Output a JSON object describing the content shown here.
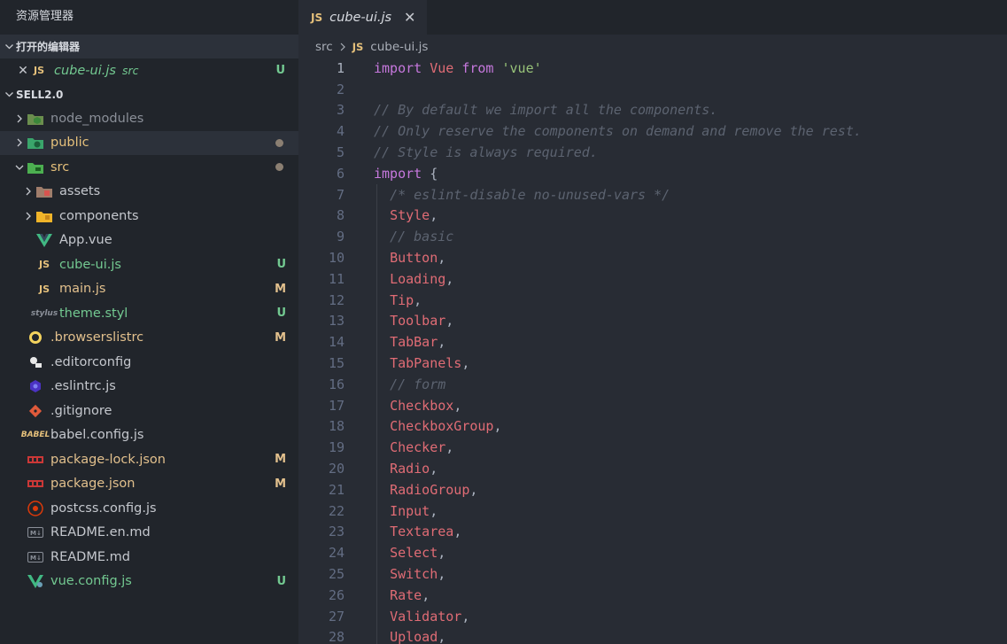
{
  "sidebar": {
    "title": "资源管理器",
    "open_editors": {
      "label": "打开的编辑器",
      "items": [
        {
          "name": "cube-ui.js",
          "folder": "src",
          "status": "U",
          "icon": "js-icon"
        }
      ]
    },
    "project": {
      "label": "SELL2.0",
      "items": [
        {
          "name": "node_modules",
          "icon": "node-folder-icon",
          "depth": 0,
          "type": "folder",
          "expanded": false,
          "color": "dim"
        },
        {
          "name": "public",
          "icon": "public-folder-icon",
          "depth": 0,
          "type": "folder",
          "expanded": false,
          "color": "folder-mod",
          "dot": true
        },
        {
          "name": "src",
          "icon": "src-folder-icon",
          "depth": 0,
          "type": "folder",
          "expanded": true,
          "color": "folder-mod",
          "dot": true
        },
        {
          "name": "assets",
          "icon": "assets-folder-icon",
          "depth": 1,
          "type": "folder",
          "expanded": false
        },
        {
          "name": "components",
          "icon": "components-folder-icon",
          "depth": 1,
          "type": "folder",
          "expanded": false
        },
        {
          "name": "App.vue",
          "icon": "vue-icon",
          "depth": 1,
          "type": "file"
        },
        {
          "name": "cube-ui.js",
          "icon": "js-icon",
          "depth": 1,
          "type": "file",
          "status": "U",
          "color": "untracked"
        },
        {
          "name": "main.js",
          "icon": "js-icon",
          "depth": 1,
          "type": "file",
          "status": "M",
          "color": "modified"
        },
        {
          "name": "theme.styl",
          "icon": "stylus-icon",
          "depth": 1,
          "type": "file",
          "status": "U",
          "color": "untracked"
        },
        {
          "name": ".browserslistrc",
          "icon": "browserslist-icon",
          "depth": 0,
          "type": "file",
          "status": "M",
          "color": "modified"
        },
        {
          "name": ".editorconfig",
          "icon": "editorconfig-icon",
          "depth": 0,
          "type": "file"
        },
        {
          "name": ".eslintrc.js",
          "icon": "eslint-icon",
          "depth": 0,
          "type": "file"
        },
        {
          "name": ".gitignore",
          "icon": "git-icon",
          "depth": 0,
          "type": "file"
        },
        {
          "name": "babel.config.js",
          "icon": "babel-icon",
          "depth": 0,
          "type": "file"
        },
        {
          "name": "package-lock.json",
          "icon": "npm-icon",
          "depth": 0,
          "type": "file",
          "status": "M",
          "color": "modified"
        },
        {
          "name": "package.json",
          "icon": "npm-icon",
          "depth": 0,
          "type": "file",
          "status": "M",
          "color": "modified"
        },
        {
          "name": "postcss.config.js",
          "icon": "postcss-icon",
          "depth": 0,
          "type": "file"
        },
        {
          "name": "README.en.md",
          "icon": "markdown-icon",
          "depth": 0,
          "type": "file"
        },
        {
          "name": "README.md",
          "icon": "markdown-icon",
          "depth": 0,
          "type": "file"
        },
        {
          "name": "vue.config.js",
          "icon": "vue-config-icon",
          "depth": 0,
          "type": "file",
          "status": "U",
          "color": "untracked"
        }
      ]
    }
  },
  "editor": {
    "tab": {
      "name": "cube-ui.js",
      "close": "✕",
      "icon": "JS"
    },
    "breadcrumb": {
      "folder": "src",
      "icon": "JS",
      "file": "cube-ui.js"
    },
    "active_line": 1,
    "lines": [
      [
        [
          "k",
          "import"
        ],
        [
          "p",
          " "
        ],
        [
          "i",
          "Vue"
        ],
        [
          "p",
          " "
        ],
        [
          "k",
          "from"
        ],
        [
          "p",
          " "
        ],
        [
          "s",
          "'vue'"
        ]
      ],
      [],
      [
        [
          "c",
          "// By default we import all the components."
        ]
      ],
      [
        [
          "c",
          "// Only reserve the components on demand and remove the rest."
        ]
      ],
      [
        [
          "c",
          "// Style is always required."
        ]
      ],
      [
        [
          "k",
          "import"
        ],
        [
          "p",
          " {"
        ]
      ],
      [
        [
          "p",
          "  "
        ],
        [
          "c",
          "/* eslint-disable no-unused-vars */"
        ]
      ],
      [
        [
          "p",
          "  "
        ],
        [
          "i",
          "Style"
        ],
        [
          "p",
          ","
        ]
      ],
      [
        [
          "p",
          "  "
        ],
        [
          "c",
          "// basic"
        ]
      ],
      [
        [
          "p",
          "  "
        ],
        [
          "i",
          "Button"
        ],
        [
          "p",
          ","
        ]
      ],
      [
        [
          "p",
          "  "
        ],
        [
          "i",
          "Loading"
        ],
        [
          "p",
          ","
        ]
      ],
      [
        [
          "p",
          "  "
        ],
        [
          "i",
          "Tip"
        ],
        [
          "p",
          ","
        ]
      ],
      [
        [
          "p",
          "  "
        ],
        [
          "i",
          "Toolbar"
        ],
        [
          "p",
          ","
        ]
      ],
      [
        [
          "p",
          "  "
        ],
        [
          "i",
          "TabBar"
        ],
        [
          "p",
          ","
        ]
      ],
      [
        [
          "p",
          "  "
        ],
        [
          "i",
          "TabPanels"
        ],
        [
          "p",
          ","
        ]
      ],
      [
        [
          "p",
          "  "
        ],
        [
          "c",
          "// form"
        ]
      ],
      [
        [
          "p",
          "  "
        ],
        [
          "i",
          "Checkbox"
        ],
        [
          "p",
          ","
        ]
      ],
      [
        [
          "p",
          "  "
        ],
        [
          "i",
          "CheckboxGroup"
        ],
        [
          "p",
          ","
        ]
      ],
      [
        [
          "p",
          "  "
        ],
        [
          "i",
          "Checker"
        ],
        [
          "p",
          ","
        ]
      ],
      [
        [
          "p",
          "  "
        ],
        [
          "i",
          "Radio"
        ],
        [
          "p",
          ","
        ]
      ],
      [
        [
          "p",
          "  "
        ],
        [
          "i",
          "RadioGroup"
        ],
        [
          "p",
          ","
        ]
      ],
      [
        [
          "p",
          "  "
        ],
        [
          "i",
          "Input"
        ],
        [
          "p",
          ","
        ]
      ],
      [
        [
          "p",
          "  "
        ],
        [
          "i",
          "Textarea"
        ],
        [
          "p",
          ","
        ]
      ],
      [
        [
          "p",
          "  "
        ],
        [
          "i",
          "Select"
        ],
        [
          "p",
          ","
        ]
      ],
      [
        [
          "p",
          "  "
        ],
        [
          "i",
          "Switch"
        ],
        [
          "p",
          ","
        ]
      ],
      [
        [
          "p",
          "  "
        ],
        [
          "i",
          "Rate"
        ],
        [
          "p",
          ","
        ]
      ],
      [
        [
          "p",
          "  "
        ],
        [
          "i",
          "Validator"
        ],
        [
          "p",
          ","
        ]
      ],
      [
        [
          "p",
          "  "
        ],
        [
          "i",
          "Upload"
        ],
        [
          "p",
          ","
        ]
      ]
    ]
  },
  "colors": {
    "keyword": "#c678dd",
    "identifier": "#e06c75",
    "string": "#98c379",
    "comment": "#5c6370",
    "untracked": "#73c991",
    "modified": "#e2c08d"
  }
}
